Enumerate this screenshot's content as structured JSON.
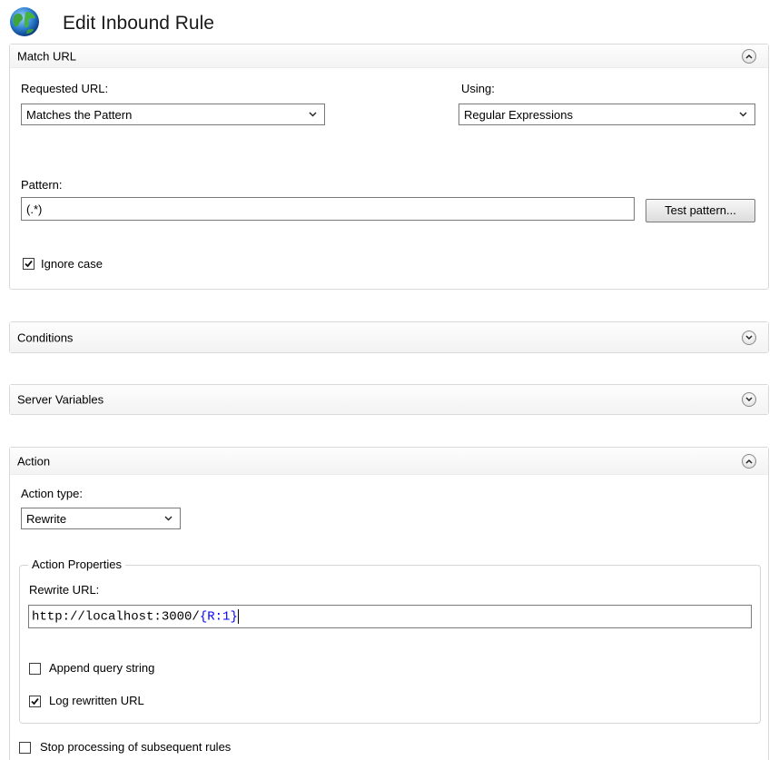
{
  "window": {
    "title": "Edit Inbound Rule"
  },
  "match_url": {
    "title": "Match URL",
    "requested_url_label": "Requested URL:",
    "requested_url_value": "Matches the Pattern",
    "using_label": "Using:",
    "using_value": "Regular Expressions",
    "pattern_label": "Pattern:",
    "pattern_value": "(.*)",
    "test_button": "Test pattern...",
    "ignore_case_label": "Ignore case",
    "ignore_case_checked": true
  },
  "conditions": {
    "title": "Conditions"
  },
  "server_variables": {
    "title": "Server Variables"
  },
  "action": {
    "title": "Action",
    "action_type_label": "Action type:",
    "action_type_value": "Rewrite",
    "properties_legend": "Action Properties",
    "rewrite_url_label": "Rewrite URL:",
    "rewrite_url_prefix": "http://localhost:3000/",
    "rewrite_url_open": "{",
    "rewrite_url_var": "R:1",
    "rewrite_url_close": "}",
    "append_query_label": "Append query string",
    "append_query_checked": false,
    "log_rewritten_label": "Log rewritten URL",
    "log_rewritten_checked": true,
    "stop_processing_label": "Stop processing of subsequent rules",
    "stop_processing_checked": false
  },
  "colors": {
    "url_variable": "#0000ff",
    "border": "#d9d9d9"
  }
}
